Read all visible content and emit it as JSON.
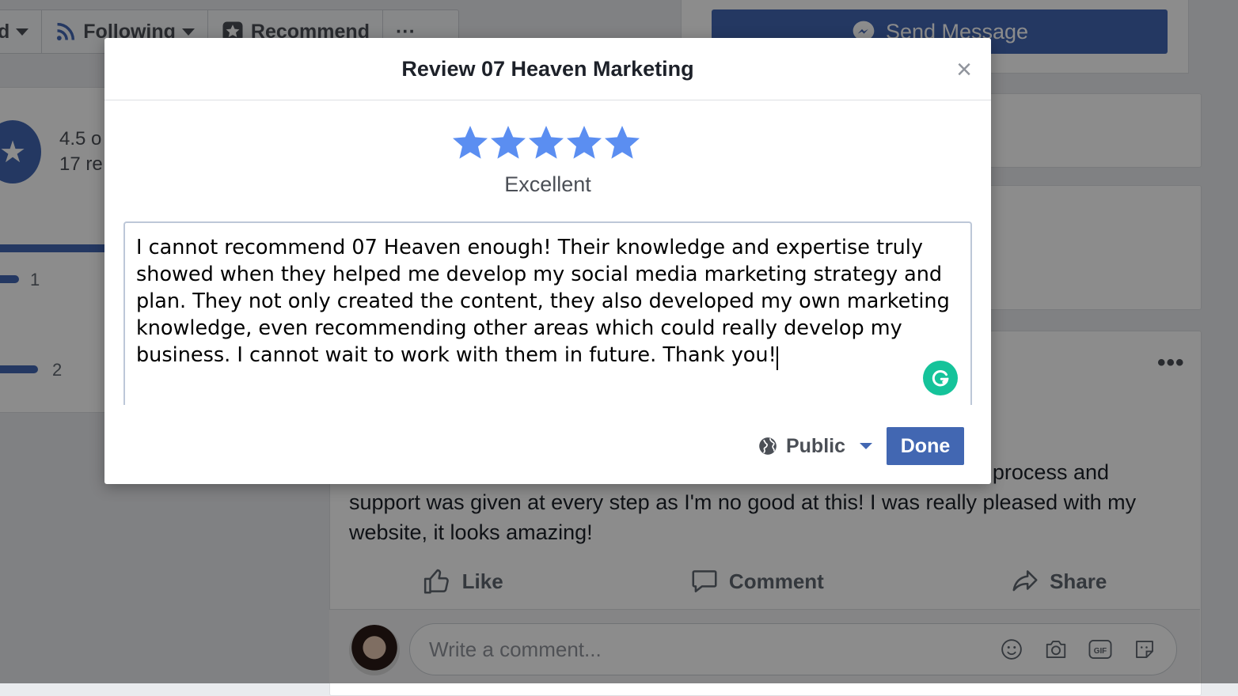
{
  "background": {
    "action_bar": {
      "truncated_label": "d",
      "following_label": "Following",
      "recommend_label": "Recommend",
      "more_label": "···"
    },
    "send_message_label": "Send Message",
    "rating_summary": {
      "score_text": "4.5 o",
      "reviews_text": "17 re"
    },
    "rating_bars": [
      {
        "count": "1"
      },
      {
        "count": "2"
      }
    ],
    "post": {
      "more_label": "•••",
      "text_line1": "process and",
      "text_rest": "support was given at every step as I'm no good at this! I was really pleased with my website, it looks amazing!",
      "actions": {
        "like": "Like",
        "comment": "Comment",
        "share": "Share"
      }
    },
    "comment": {
      "placeholder": "Write a comment..."
    }
  },
  "modal": {
    "title": "Review 07 Heaven Marketing",
    "close_glyph": "×",
    "rating": {
      "stars_filled": 5,
      "stars_total": 5,
      "label": "Excellent"
    },
    "review_text": "I cannot recommend 07 Heaven enough! Their knowledge and expertise truly showed when they helped me develop my social media marketing strategy and plan. They not only created the content, they also developed my own marketing knowledge, even recommending other areas which could really develop my business. I cannot wait to work with them in future. Thank you!",
    "privacy_label": "Public",
    "done_label": "Done"
  },
  "colors": {
    "accent": "#4267b2",
    "star": "#5b8ef1",
    "grammarly": "#15c39a"
  }
}
